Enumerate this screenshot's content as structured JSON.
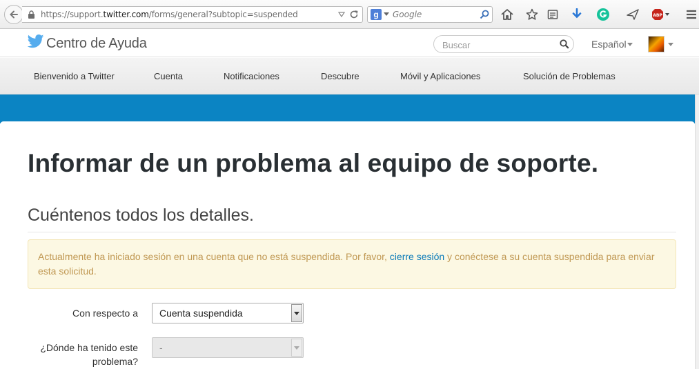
{
  "browser": {
    "url_prefix": "https://support.",
    "url_domain": "twitter.com",
    "url_suffix": "/forms/general?subtopic=suspended",
    "search_engine_placeholder": "Google",
    "icons": [
      "back-arrow-icon",
      "lock-icon",
      "dropdown-marker-icon",
      "reload-icon",
      "google-icon",
      "search-icon",
      "home-icon",
      "bookmark-star-icon",
      "reading-list-icon",
      "download-icon",
      "grammarly-icon",
      "send-icon",
      "adblock-plus-icon",
      "menu-icon"
    ]
  },
  "site": {
    "title": "Centro de Ayuda",
    "search_placeholder": "Buscar",
    "language": "Español"
  },
  "nav": {
    "items": [
      {
        "label": "Bienvenido a Twitter"
      },
      {
        "label": "Cuenta"
      },
      {
        "label": "Notificaciones"
      },
      {
        "label": "Descubre"
      },
      {
        "label": "Móvil y Aplicaciones"
      },
      {
        "label": "Solución de Problemas"
      }
    ]
  },
  "page": {
    "title": "Informar de un problema al equipo de soporte.",
    "section_title": "Cuéntenos todos los detalles.",
    "alert": {
      "before": "Actualmente ha iniciado sesión en una cuenta que no está suspendida. Por favor, ",
      "link": "cierre sesión",
      "after": " y conéctese a su cuenta suspendida para enviar esta solicitud."
    },
    "form": {
      "regarding_label": "Con respecto a",
      "regarding_value": "Cuenta suspendida",
      "where_label_line1": "¿Dónde ha tenido este",
      "where_label_line2": "problema?",
      "where_value": "-"
    }
  },
  "colors": {
    "banner": "#0b84c3",
    "twitter_blue": "#55acee",
    "alert_bg": "#fcf8e3",
    "alert_text": "#c09853",
    "link": "#0a7ab8"
  }
}
